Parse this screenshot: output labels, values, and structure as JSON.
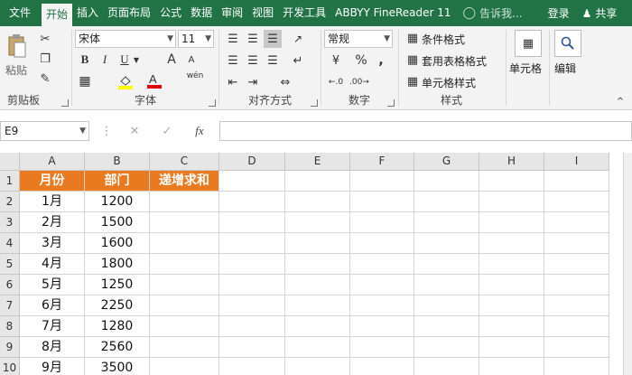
{
  "menu": {
    "tabs": [
      "文件",
      "开始",
      "插入",
      "页面布局",
      "公式",
      "数据",
      "审阅",
      "视图",
      "开发工具",
      "ABBYY FineReader 11"
    ],
    "active_tab": "开始",
    "tell_me": "告诉我...",
    "login": "登录",
    "share": "共享"
  },
  "ribbon": {
    "clipboard": {
      "paste": "粘贴",
      "label": "剪贴板"
    },
    "font": {
      "name": "宋体",
      "size": "11",
      "label": "字体",
      "bold": "B",
      "italic": "I",
      "underline": "U",
      "grow": "A",
      "shrink": "A",
      "phonetic": "wén"
    },
    "alignment": {
      "label": "对齐方式"
    },
    "number": {
      "format": "常规",
      "label": "数字",
      "percent": "%",
      "comma": ","
    },
    "styles": {
      "conditional": "条件格式",
      "table": "套用表格格式",
      "cell": "单元格样式",
      "label": "样式"
    },
    "cells": {
      "label": "单元格"
    },
    "editing": {
      "label": "编辑"
    }
  },
  "formula_bar": {
    "name_box": "E9",
    "formula": ""
  },
  "sheet": {
    "columns": [
      "A",
      "B",
      "C",
      "D",
      "E",
      "F",
      "G",
      "H",
      "I"
    ],
    "rows": [
      "1",
      "2",
      "3",
      "4",
      "5",
      "6",
      "7",
      "8",
      "9",
      "10"
    ],
    "header": [
      "月份",
      "部门",
      "递增求和"
    ],
    "data": [
      [
        "1月",
        "1200",
        ""
      ],
      [
        "2月",
        "1500",
        ""
      ],
      [
        "3月",
        "1600",
        ""
      ],
      [
        "4月",
        "1800",
        ""
      ],
      [
        "5月",
        "1250",
        ""
      ],
      [
        "6月",
        "2250",
        ""
      ],
      [
        "7月",
        "1280",
        ""
      ],
      [
        "8月",
        "2560",
        ""
      ],
      [
        "9月",
        "3500",
        ""
      ]
    ]
  },
  "colors": {
    "accent": "#217346",
    "header_fill": "#E97A1F"
  }
}
